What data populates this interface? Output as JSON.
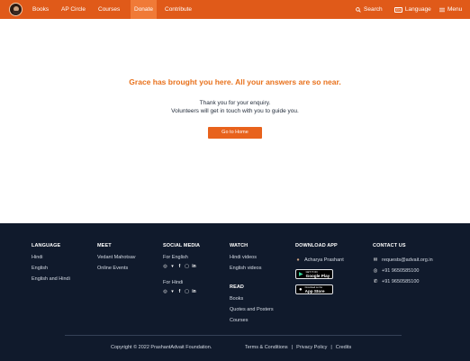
{
  "header": {
    "nav": [
      "Books",
      "AP Circle",
      "Courses",
      "Donate",
      "Contribute"
    ],
    "search_label": "Search",
    "language_label": "Language",
    "language_icon_text": "EN",
    "menu_label": "Menu",
    "brand_color": "#e05a19"
  },
  "main": {
    "headline": "Grace has brought you here. All your answers are so near.",
    "line1": "Thank you for your enquiry.",
    "line2": "Volunteers will get in touch with you to guide you.",
    "button_label": "Go to Home",
    "accent_color": "#e8711c"
  },
  "footer": {
    "language": {
      "heading": "LANGUAGE",
      "items": [
        "Hindi",
        "English",
        "English and Hindi"
      ]
    },
    "meet": {
      "heading": "MEET",
      "items": [
        "Vedant Mahotsav",
        "Online Events"
      ]
    },
    "social": {
      "heading": "SOCIAL MEDIA",
      "for_english": "For English",
      "for_hindi": "For Hindi",
      "icons": [
        "whatsapp-icon",
        "twitter-icon",
        "facebook-icon",
        "instagram-icon",
        "linkedin-icon"
      ]
    },
    "watch": {
      "heading": "WATCH",
      "items": [
        "Hindi videos",
        "English videos"
      ]
    },
    "read": {
      "heading": "READ",
      "items": [
        "Books",
        "Quotes and Posters",
        "Courses"
      ]
    },
    "download": {
      "heading": "DOWNLOAD APP",
      "app_name": "Acharya Prashant",
      "google_small": "GET IT ON",
      "google_big": "Google Play",
      "apple_small": "Download on the",
      "apple_big": "App Store"
    },
    "contact": {
      "heading": "CONTACT US",
      "email": "requests@advait.org.in",
      "whatsapp": "+91 9650585100",
      "phone": "+91 9650585100"
    },
    "copyright": "Copyright © 2022 PrashantAdvait Foundation.",
    "legal": [
      "Terms & Conditions",
      "|",
      "Privacy Policy",
      "|",
      "Credits"
    ],
    "bg_color": "#101a2c"
  }
}
